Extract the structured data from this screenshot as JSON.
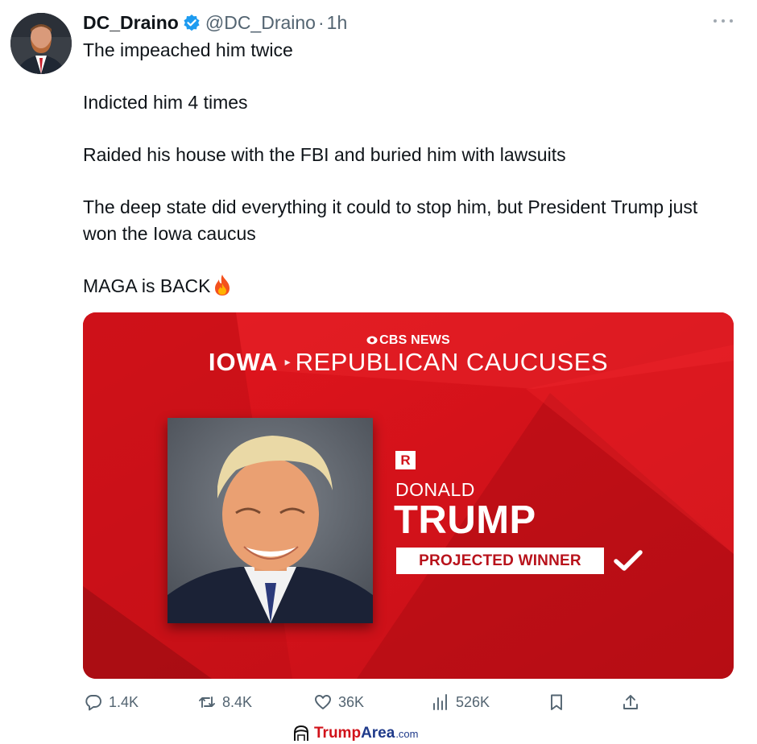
{
  "author": {
    "display_name": "DC_Draino",
    "handle": "@DC_Draino",
    "separator": "·",
    "time": "1h",
    "verified": true,
    "avatar_icon": "profile-photo"
  },
  "tweet": {
    "lines": [
      "The impeached him twice",
      "Indicted him 4 times",
      "Raided his house with the FBI and buried him with lawsuits",
      "The deep state did everything it could to stop him, but President Trump just won the Iowa caucus",
      "MAGA is BACK"
    ],
    "emoji": "fire-emoji"
  },
  "media": {
    "network": "CBS NEWS",
    "state": "IOWA",
    "race": "REPUBLICAN CAUCUSES",
    "party": "R",
    "first_name": "DONALD",
    "last_name": "TRUMP",
    "status": "PROJECTED WINNER",
    "colors": {
      "background": "#d1121a",
      "accent": "#b8121b"
    }
  },
  "actions": {
    "replies": "1.4K",
    "reposts": "8.4K",
    "likes": "36K",
    "views": "526K"
  },
  "watermark": {
    "part1": "Trump",
    "part2": "Area",
    "suffix": ".com"
  }
}
